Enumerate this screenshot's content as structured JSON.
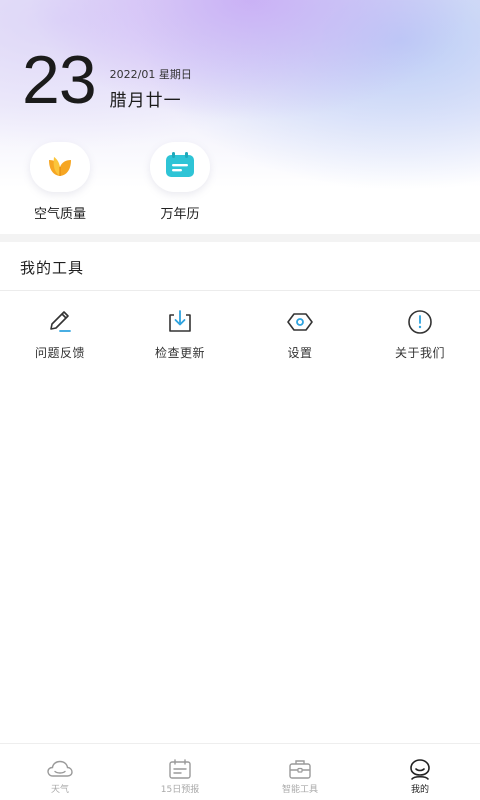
{
  "header": {
    "day": "23",
    "year_month_weekday": "2022/01 星期日",
    "lunar_date": "腊月廿一"
  },
  "quick_actions": [
    {
      "label": "空气质量",
      "icon": "leaf-icon"
    },
    {
      "label": "万年历",
      "icon": "calendar-icon"
    }
  ],
  "tools": {
    "title": "我的工具",
    "items": [
      {
        "label": "问题反馈",
        "icon": "pencil-icon"
      },
      {
        "label": "检查更新",
        "icon": "download-icon"
      },
      {
        "label": "设置",
        "icon": "settings-hexagon-icon"
      },
      {
        "label": "关于我们",
        "icon": "info-icon"
      }
    ]
  },
  "tabbar": {
    "items": [
      {
        "label": "天气",
        "icon": "cloud-icon",
        "active": false
      },
      {
        "label": "15日预报",
        "icon": "calendar-icon",
        "active": false
      },
      {
        "label": "智能工具",
        "icon": "toolbox-icon",
        "active": false
      },
      {
        "label": "我的",
        "icon": "profile-icon",
        "active": true
      }
    ]
  },
  "colors": {
    "leaf_orange": "#F6A623",
    "calendar_teal": "#2EC4D6",
    "active_text": "#222222",
    "inactive_text": "#A9A9A9"
  }
}
